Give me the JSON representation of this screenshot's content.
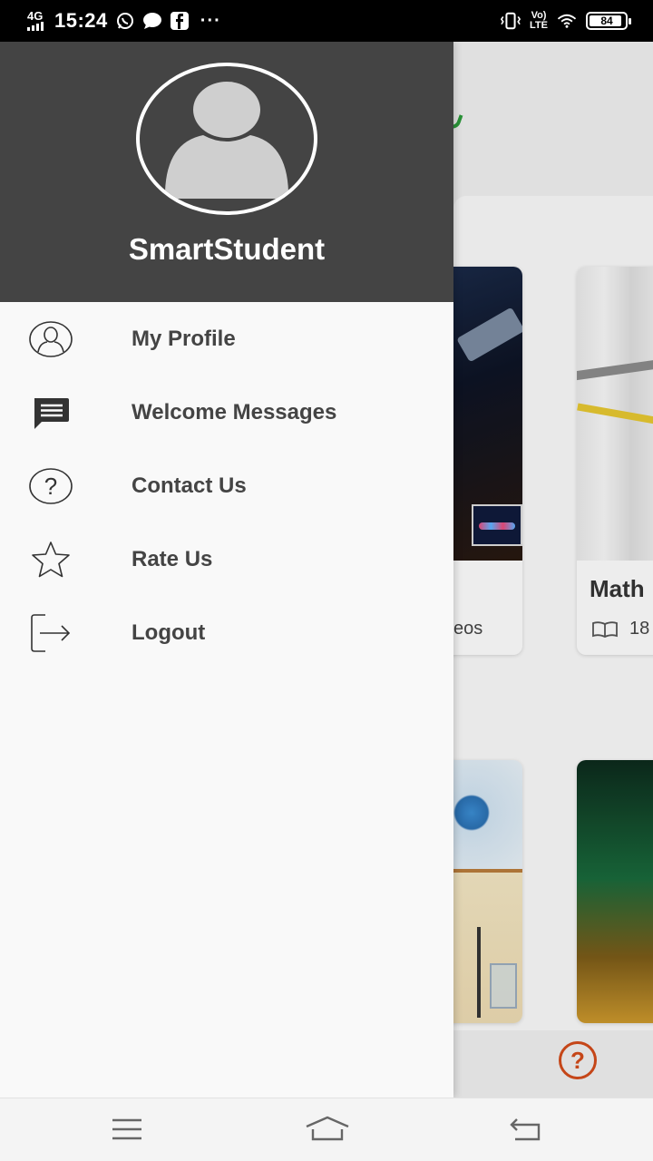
{
  "status_bar": {
    "network": "4G",
    "time": "15:24",
    "more": "···",
    "volte_top": "Vo)",
    "volte_bottom": "LTE",
    "battery_level": "84"
  },
  "background_app": {
    "card_a_sub": "eos",
    "card_b_title": "Math",
    "card_b_sub": "18",
    "help_glyph": "?"
  },
  "drawer": {
    "username": "SmartStudent",
    "menu": [
      {
        "label": "My Profile",
        "icon": "profile-icon"
      },
      {
        "label": "Welcome Messages",
        "icon": "message-icon"
      },
      {
        "label": "Contact Us",
        "icon": "help-icon"
      },
      {
        "label": "Rate Us",
        "icon": "star-icon"
      },
      {
        "label": "Logout",
        "icon": "logout-icon"
      }
    ]
  },
  "nav_bar": {
    "buttons": [
      "menu-icon",
      "home-icon",
      "back-icon"
    ]
  },
  "colors": {
    "drawer_header": "#444444",
    "accent_help": "#d04a1a"
  }
}
